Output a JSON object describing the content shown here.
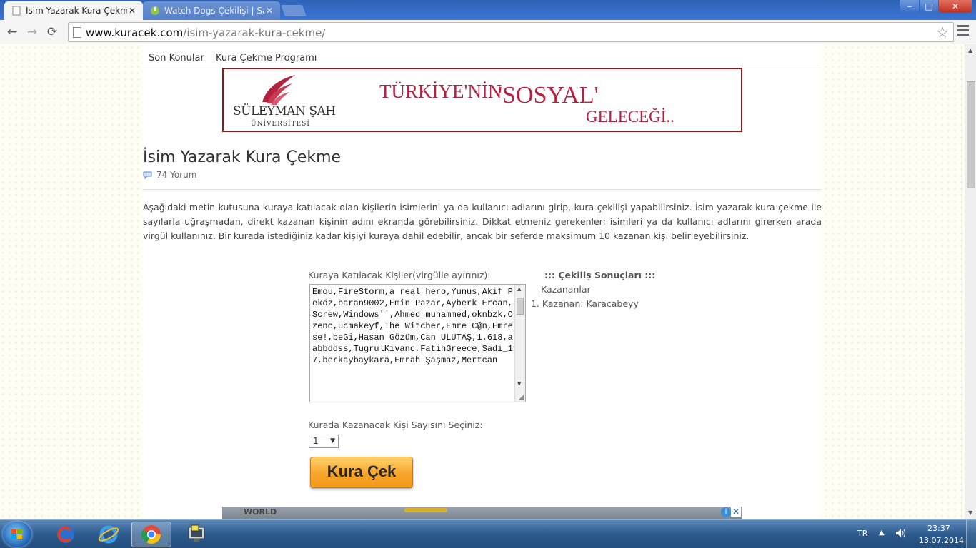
{
  "browser": {
    "tabs": [
      {
        "title": "İsim Yazarak Kura Çekme | ",
        "active": true
      },
      {
        "title": "Watch Dogs Çekilişi | Sayfa",
        "active": false
      }
    ],
    "url_host": "www.kuracek.com",
    "url_path": "/isim-yazarak-kura-cekme/",
    "window_buttons": {
      "minimize": "–",
      "maximize": "□",
      "close": "✕"
    }
  },
  "nav": {
    "items": [
      "Son Konular",
      "Kura Çekme Programı"
    ]
  },
  "banner": {
    "uni_name": "SÜLEYMAN ŞAH",
    "uni_sub": "ÜNİVERSİTESİ",
    "slogan1": "TÜRKİYE'NİN",
    "slogan2": "'SOSYAL'",
    "slogan3": "GELECEĞİ..",
    "accent": "#b5223f"
  },
  "page": {
    "title": "İsim Yazarak Kura Çekme",
    "comments": "74 Yorum",
    "intro": "Aşağıdaki metin kutusuna kuraya katılacak olan kişilerin isimlerini ya da kullanıcı adlarını girip, kura çekilişi yapabilirsiniz. İsim yazarak kura çekme ile sayılarla uğraşmadan, direkt kazanan kişinin adını ekranda görebilirsiniz. Dikkat etmeniz gerekenler; isimleri ya da kullanıcı adlarını girerken arada virgül kullanınız. Bir kurada istediğiniz kadar kişiyi kuraya dahil edebilir, ancak bir seferde maksimum 10 kazanan kişi belirleyebilirsiniz."
  },
  "form": {
    "entries_label": "Kuraya Katılacak Kişiler(virgülle ayırınız):",
    "entries_value": "Emou,FireStorm,a real hero,Yunus,Akif Peköz,baran9002,Emin Pazar,Ayberk Ercan,Screw,Windows'',Ahmed muhammed,oknbzk,Ozenc,ucmakeyf,The Witcher,Emre C@n,Emrese!,beGi,Hasan Gözüm,Can ULUTAŞ,1.618,aabbddss,TugrulKivanc,FatihGreece,Sadi_17,berkaybaykara,Emrah Şaşmaz,Mertcan",
    "count_label": "Kurada Kazanacak Kişi Sayısını Seçiniz:",
    "count_value": "1",
    "draw_button": "Kura Çek"
  },
  "results": {
    "title": "::: Çekiliş Sonuçları :::",
    "winners_label": "Kazananlar",
    "winners": [
      "1. Kazanan: Karacabeyy"
    ]
  },
  "ad": {
    "text": "WORLD",
    "info": "i",
    "close": "✕"
  },
  "taskbar": {
    "language": "TR",
    "time": "23:37",
    "date": "13.07.2014"
  }
}
